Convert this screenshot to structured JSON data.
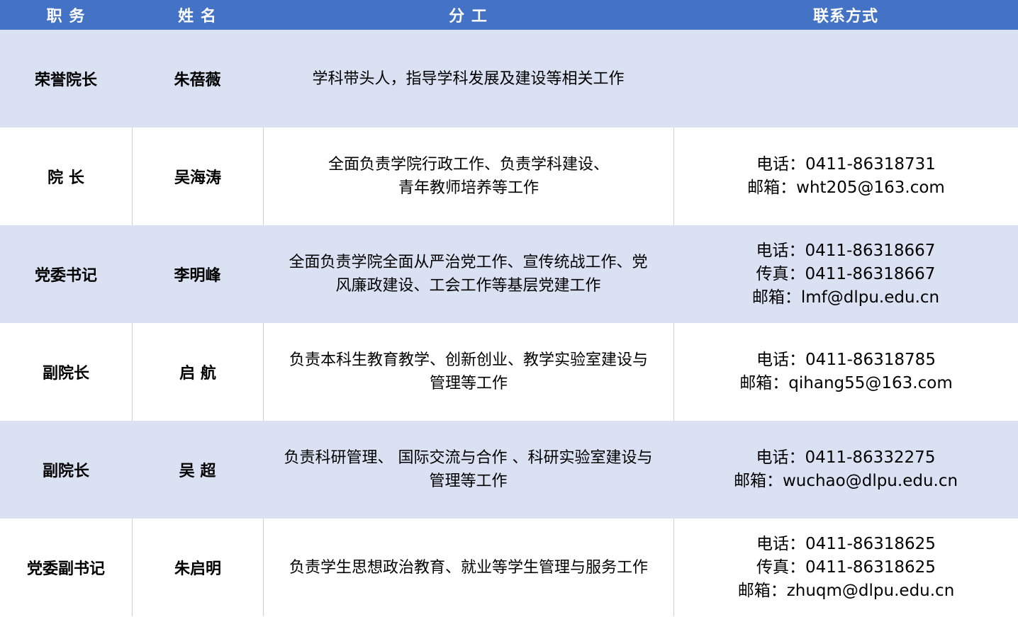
{
  "header": {
    "title": "职 务",
    "name": "姓 名",
    "duty": "分 工",
    "contact": "联系方式"
  },
  "rows": [
    {
      "title": "荣誉院长",
      "name": "朱蓓薇",
      "duty": [
        "学科带头人，指导学科发展及建设等相关工作"
      ],
      "contact": []
    },
    {
      "title": "院 长",
      "name": "吴海涛",
      "duty": [
        "全面负责学院行政工作、负责学科建设、",
        "青年教师培养等工作"
      ],
      "contact": [
        "电话：0411-86318731",
        "邮箱：wht205@163.com"
      ]
    },
    {
      "title": "党委书记",
      "name": "李明峰",
      "duty": [
        "全面负责学院全面从严治党工作、宣传统战工作、党",
        "风廉政建设、工会工作等基层党建工作"
      ],
      "contact": [
        "电话：0411-86318667",
        "传真：0411-86318667",
        "邮箱：lmf@dlpu.edu.cn"
      ]
    },
    {
      "title": "副院长",
      "name": "启 航",
      "duty": [
        "负责本科生教育教学、创新创业、教学实验室建设与",
        "管理等工作"
      ],
      "contact": [
        "电话：0411-86318785",
        "邮箱：qihang55@163.com"
      ]
    },
    {
      "title": "副院长",
      "name": "吴 超",
      "duty": [
        "负责科研管理、 国际交流与合作 、科研实验室建设与",
        "管理等工作"
      ],
      "contact": [
        "电话：0411-86332275",
        "邮箱：wuchao@dlpu.edu.cn"
      ]
    },
    {
      "title": "党委副书记",
      "name": "朱启明",
      "duty": [
        "负责学生思想政治教育、就业等学生管理与服务工作"
      ],
      "contact": [
        "电话：0411-86318625",
        "传真：0411-86318625",
        "邮箱：zhuqm@dlpu.edu.cn"
      ]
    }
  ],
  "colors": {
    "header_bg": "#4472c4",
    "shaded_row": "#d9e1f2",
    "plain_row": "#ffffff"
  }
}
